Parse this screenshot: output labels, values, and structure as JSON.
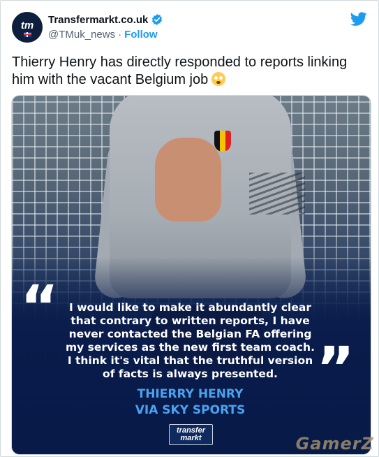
{
  "tweet": {
    "avatar_label": "tm",
    "display_name": "Transfermarkt.co.uk",
    "handle": "@TMuk_news",
    "separator": "·",
    "follow_label": "Follow",
    "text": "Thierry Henry has directly responded to reports linking him with the vacant Belgium job",
    "emoji": "flushed-face-emoji"
  },
  "media": {
    "quote_open": "“",
    "quote_close": "”",
    "quote_lines": [
      "I would like to make it abundantly clear",
      "that contrary to written reports, I have",
      "never contacted the Belgian FA offering",
      "my services as the new first team coach.",
      "I think it's vital that the truthful version",
      "of facts is always presented."
    ],
    "attribution": [
      "THIERRY HENRY",
      "VIA SKY SPORTS"
    ],
    "logo_lines": [
      "transfer",
      "markt"
    ]
  },
  "watermark": "GamerZ",
  "colors": {
    "accent": "#1d9bf0",
    "attribution": "#4aa3f0",
    "media_bg": "#0e2860"
  }
}
